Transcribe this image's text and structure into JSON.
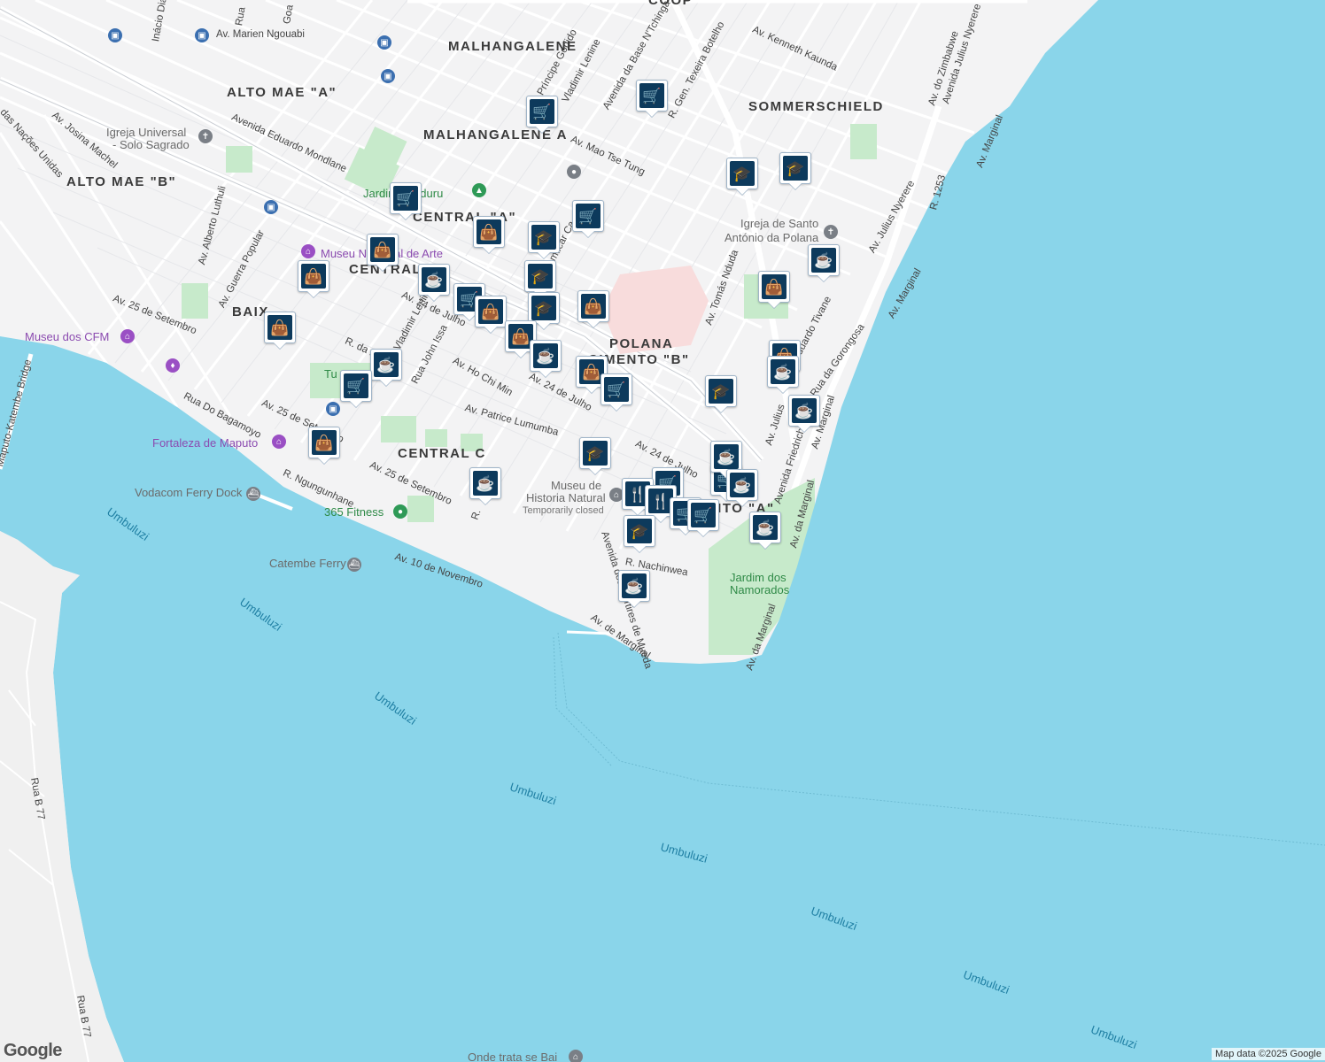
{
  "map": {
    "colors": {
      "water": "#8ad5ea",
      "land": "#f3f3f4",
      "road": "#ffffff",
      "park": "#c7eacb",
      "highlight": "#f8dcdc"
    },
    "attribution": "Map data ©2025 Google",
    "logo": "Google"
  },
  "labels": {
    "districts": [
      "MALHANGALENE",
      "ALTO MAE \"A\"",
      "SOMMERSCHIELD",
      "MALHANGALENE A",
      "ALTO MAE \"B\"",
      "CENTRAL \"A\"",
      "CENTRAL",
      "BAIX",
      "POLANA",
      "CIMENTO \"B\"",
      "CENTRAL C",
      "CIMENTO \"A\"",
      "COOP"
    ],
    "streets": [
      "Av. Marien Ngouabi",
      "Av. Kenneth Kaunda",
      "Avenida Julius Nyerere",
      "Av. do Zimbabwe",
      "Avenida da Base N'Tchinga",
      "R. Gen. Texeira Botelho",
      "Príncipe Godido",
      "Vladimir Lenine",
      "Av. Josina Machel",
      "Avenida Eduardo Mondlane",
      "Av. Mao Tse Tung",
      "Av. Alberto Luthuli",
      "Av. Guerra Popular",
      "Av. 25 de Setembro",
      "Av. 24 de Julho",
      "Rua John Issa",
      "Av. Ho Chi Min",
      "Av. Patrice Lumumba",
      "Av. Tomás Nduda",
      "Rua da Gorongosa",
      "Avenida Friedrich",
      "Av. Marginal",
      "Av. da Marginal",
      "R. 1253",
      "Av. Julius Nyerere",
      "Av. 10 de Novembro",
      "R. Ngungunhane",
      "Rua Do Bagamoyo",
      "Avenida dos Martires de Mueda",
      "R. Nachinwea",
      "Av. de Marginal",
      "Rua B 77",
      "das Nações Unidas",
      "Goa",
      "Rua",
      "Inácio Dias",
      "Vladimir Lenine",
      "Amílcar Ca",
      "R. da R",
      "Av. Julius",
      "Eduardo Tivane",
      "Maputo-Katembe Bridge",
      "Rua B 77",
      "R."
    ],
    "water": [
      "Umbuluzi"
    ],
    "pois": [
      {
        "name": "Igreja Universal - Solo Sagrado",
        "color": "gray"
      },
      {
        "name": "Jardim Tunduru (Jardim Dona Berta)",
        "color": "green"
      },
      {
        "name": "Museu Nacional de Arte",
        "color": "purple"
      },
      {
        "name": "Igreja de Santo António da Polana",
        "color": "gray"
      },
      {
        "name": "Museu dos CFM",
        "color": "purple"
      },
      {
        "name": "Fortaleza de Maputo",
        "color": "purple"
      },
      {
        "name": "Vodacom Ferry Dock",
        "color": "gray"
      },
      {
        "name": "365 Fitness",
        "color": "green"
      },
      {
        "name": "Catembe Ferry",
        "color": "gray"
      },
      {
        "name": "Museu de Historia Natural",
        "color": "gray"
      },
      {
        "name": "Temporarily closed",
        "color": "gray"
      },
      {
        "name": "Jardim dos Namorados",
        "color": "green"
      },
      {
        "name": "Onde trata se Bai",
        "color": "gray"
      }
    ]
  },
  "text": {
    "d_malhangalene": "MALHANGALENE",
    "d_altomaeA": "ALTO MAE \"A\"",
    "d_sommer": "SOMMERSCHIELD",
    "d_malhA": "MALHANGALENE A",
    "d_altomaeB": "ALTO MAE \"B\"",
    "d_centralA": "CENTRAL \"A\"",
    "d_central": "CENTRAL",
    "d_baix": "BAIX",
    "d_polana": "POLANA",
    "d_cimentoB": "CIMENTO \"B\"",
    "d_centralC": "CENTRAL C",
    "d_cimentoA": "CIMENTO \"A\"",
    "d_coop": "COOP",
    "s_marien": "Av. Marien Ngouabi",
    "s_kaunda": "Av. Kenneth Kaunda",
    "s_nyerere_top": "Avenida Julius Nyerere",
    "s_zimbabwe": "Av. do Zimbabwe",
    "s_base": "Avenida da Base N'Tchinga",
    "s_texeira": "R. Gen. Texeira Botelho",
    "s_godido": "Príncipe Godido",
    "s_lenine": "Vladimir Lenine",
    "s_josina": "Av. Josina Machel",
    "s_mondlane": "Avenida Eduardo Mondlane",
    "s_mao": "Av. Mao Tse Tung",
    "s_luthuli": "Av. Alberto Luthuli",
    "s_guerra": "Av. Guerra Popular",
    "s_25set1": "Av. 25 de Setembro",
    "s_25set2": "Av. 25 de Setembro",
    "s_25set3": "Av. 25 de Setembro",
    "s_24jul1": "Av. 24 de Julho",
    "s_24jul2": "Av. 24 de Julho",
    "s_24jul3": "Av. 24 de Julho",
    "s_john": "Rua John Issa",
    "s_hochi": "Av. Ho Chi Min",
    "s_lumumba": "Av. Patrice Lumumba",
    "s_nduda": "Av. Tomás Nduda",
    "s_gorongosa": "Rua da Gorongosa",
    "s_friedrich": "Avenida Friedrich",
    "s_marginal1": "Av. Marginal",
    "s_marginal2": "Av. Marginal",
    "s_marginal3": "Av. Marginal",
    "s_damarg1": "Av. da Marginal",
    "s_damarg2": "Av. da Marginal",
    "s_damarg3": "Av. da Marginal",
    "s_r1253": "R. 1253",
    "s_nyerere2": "Av. Julius Nyerere",
    "s_10nov": "Av. 10 de Novembro",
    "s_ngung": "R. Ngungunhane",
    "s_bagamoyo": "Rua Do Bagamoyo",
    "s_mueda": "Avenida dos Martires de Mueda",
    "s_nachinwea": "R. Nachinwea",
    "s_demarg": "Av. de Marginal",
    "s_rb77a": "Rua B 77",
    "s_rb77b": "Rua B 77",
    "s_nacoes": "das Nações Unidas",
    "s_goa": "Goa",
    "s_rua": "Rua",
    "s_inacio": "Inácio Dias",
    "s_lenine2": "Vladimir Lenine",
    "s_amilcar": "Amílcar Ca",
    "s_rdar": "R. da R",
    "s_julius3": "Av. Julius",
    "s_tivane": "Eduardo Tivane",
    "s_bridge": "Maputo-Katembe Bridge",
    "s_r": "R.",
    "w1": "Umbuluzi",
    "w2": "Umbuluzi",
    "w3": "Umbuluzi",
    "w4": "Umbuluzi",
    "w5": "Umbuluzi",
    "w6": "Umbuluzi",
    "w7": "Umbuluzi",
    "w8": "Umbuluzi",
    "p_igreja": "Igreja Universal",
    "p_igreja2": "- Solo Sagrado",
    "p_jardim": "Jardim Tunduru",
    "p_museu_arte": "Museu Nacional de Arte",
    "p_santo1": "Igreja de Santo",
    "p_santo2": "António da Polana",
    "p_cfm": "Museu dos CFM",
    "p_fortaleza": "Fortaleza de Maputo",
    "p_vodacom": "Vodacom Ferry Dock",
    "p_365": "365 Fitness",
    "p_catembe": "Catembe Ferry",
    "p_museu1": "Museu de",
    "p_museu2": "Historia Natural",
    "p_closed": "Temporarily closed",
    "p_namorados1": "Jardim dos",
    "p_namorados2": "Namorados",
    "p_onde": "Onde trata se Bai",
    "p_tu": "Tu"
  },
  "markers": [
    {
      "type": "shopping-cart",
      "icon": "cart"
    },
    {
      "type": "shopping-cart",
      "icon": "cart"
    },
    {
      "type": "shopping-cart",
      "icon": "cart"
    },
    {
      "type": "shopping-cart",
      "icon": "cart"
    },
    {
      "type": "school",
      "icon": "cap"
    },
    {
      "type": "school",
      "icon": "cap"
    },
    {
      "type": "shopping-bag",
      "icon": "bag"
    },
    {
      "type": "school",
      "icon": "cap"
    },
    {
      "type": "shopping-bag",
      "icon": "bag"
    },
    {
      "type": "cafe",
      "icon": "cup"
    },
    {
      "type": "school",
      "icon": "cap"
    },
    {
      "type": "shopping-bag",
      "icon": "bag"
    },
    {
      "type": "shopping-bag",
      "icon": "bag"
    },
    {
      "type": "cafe",
      "icon": "cup"
    },
    {
      "type": "shopping-cart",
      "icon": "cart"
    },
    {
      "type": "shopping-bag",
      "icon": "bag"
    },
    {
      "type": "school",
      "icon": "cap"
    },
    {
      "type": "shopping-bag",
      "icon": "bag"
    },
    {
      "type": "shopping-bag",
      "icon": "bag"
    },
    {
      "type": "shopping-bag",
      "icon": "bag"
    },
    {
      "type": "cafe",
      "icon": "cup"
    },
    {
      "type": "shopping-bag",
      "icon": "bag"
    },
    {
      "type": "shopping-cart",
      "icon": "cart"
    },
    {
      "type": "shopping-bag",
      "icon": "bag"
    },
    {
      "type": "cafe",
      "icon": "cup"
    },
    {
      "type": "shopping-cart",
      "icon": "cart"
    },
    {
      "type": "school",
      "icon": "cap"
    },
    {
      "type": "shopping-bag",
      "icon": "bag"
    },
    {
      "type": "cafe",
      "icon": "cup"
    },
    {
      "type": "school",
      "icon": "cap"
    },
    {
      "type": "shopping-cart",
      "icon": "cart"
    },
    {
      "type": "cafe",
      "icon": "cup"
    },
    {
      "type": "cafe",
      "icon": "cup"
    },
    {
      "type": "cafe",
      "icon": "cup"
    },
    {
      "type": "shopping-cart",
      "icon": "cart"
    },
    {
      "type": "restaurant",
      "icon": "fork"
    },
    {
      "type": "restaurant",
      "icon": "fork"
    },
    {
      "type": "shopping-cart",
      "icon": "cart"
    },
    {
      "type": "shopping-cart",
      "icon": "cart"
    },
    {
      "type": "school",
      "icon": "cap"
    },
    {
      "type": "cafe",
      "icon": "cup"
    },
    {
      "type": "cafe",
      "icon": "cup"
    },
    {
      "type": "cafe",
      "icon": "cup"
    }
  ]
}
